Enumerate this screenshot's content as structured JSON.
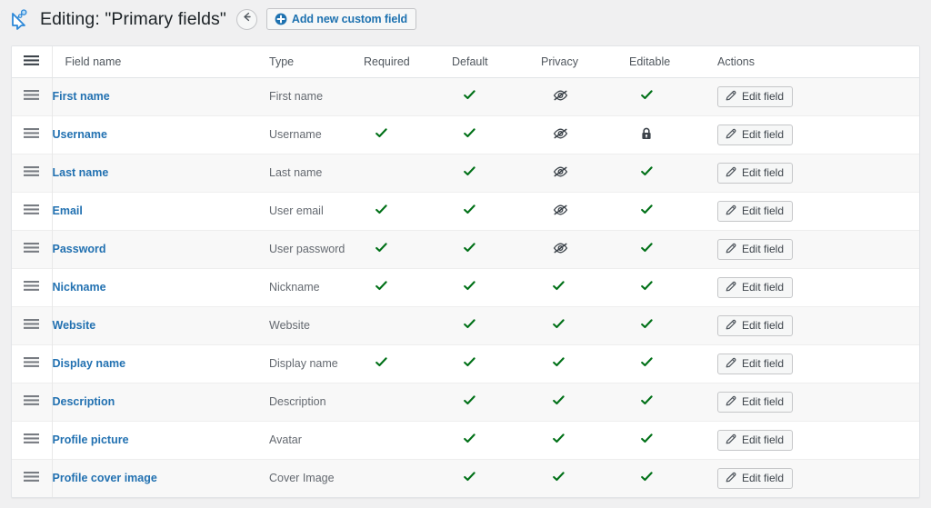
{
  "header": {
    "logo_icon": "buddypress-logo-icon",
    "title": "Editing: \"Primary fields\"",
    "back_button": {
      "icon": "arrow-left-icon",
      "aria_label": "Go back"
    },
    "add_field_button": {
      "icon": "plus-circle-icon",
      "label": "Add new custom field"
    }
  },
  "table": {
    "handle_header_icon": "menu-icon",
    "columns": [
      "Field name",
      "Type",
      "Required",
      "Default",
      "Privacy",
      "Editable",
      "Actions"
    ],
    "action_label": "Edit field",
    "action_icon": "pencil-icon",
    "row_handle_icon": "drag-handle-icon",
    "icons": {
      "check": "check-icon",
      "hidden": "eye-slash-icon",
      "lock": "lock-icon"
    },
    "rows": [
      {
        "name": "First name",
        "type": "First name",
        "required": "",
        "default": "check",
        "privacy": "hidden",
        "editable": "check"
      },
      {
        "name": "Username",
        "type": "Username",
        "required": "check",
        "default": "check",
        "privacy": "hidden",
        "editable": "lock"
      },
      {
        "name": "Last name",
        "type": "Last name",
        "required": "",
        "default": "check",
        "privacy": "hidden",
        "editable": "check"
      },
      {
        "name": "Email",
        "type": "User email",
        "required": "check",
        "default": "check",
        "privacy": "hidden",
        "editable": "check"
      },
      {
        "name": "Password",
        "type": "User password",
        "required": "check",
        "default": "check",
        "privacy": "hidden",
        "editable": "check"
      },
      {
        "name": "Nickname",
        "type": "Nickname",
        "required": "check",
        "default": "check",
        "privacy": "check",
        "editable": "check"
      },
      {
        "name": "Website",
        "type": "Website",
        "required": "",
        "default": "check",
        "privacy": "check",
        "editable": "check"
      },
      {
        "name": "Display name",
        "type": "Display name",
        "required": "check",
        "default": "check",
        "privacy": "check",
        "editable": "check"
      },
      {
        "name": "Description",
        "type": "Description",
        "required": "",
        "default": "check",
        "privacy": "check",
        "editable": "check"
      },
      {
        "name": "Profile picture",
        "type": "Avatar",
        "required": "",
        "default": "check",
        "privacy": "check",
        "editable": "check"
      },
      {
        "name": "Profile cover image",
        "type": "Cover Image",
        "required": "",
        "default": "check",
        "privacy": "check",
        "editable": "check"
      }
    ]
  },
  "colors": {
    "link": "#2271b1",
    "accent": "#1e72b0",
    "check_green": "#007017",
    "page_bg": "#f0f0f1",
    "row_stripe": "#f8f8f8"
  }
}
